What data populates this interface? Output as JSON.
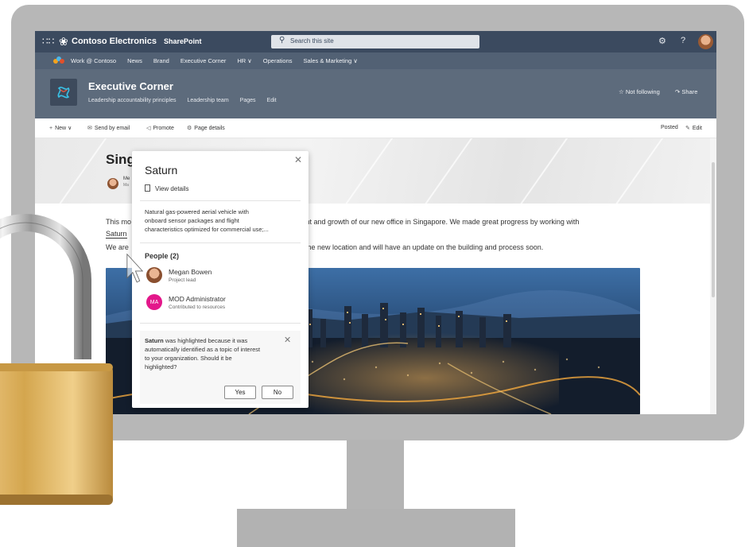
{
  "suite_bar": {
    "brand": "Contoso Electronics",
    "app": "SharePoint",
    "search_placeholder": "Search this site",
    "help": "?"
  },
  "hub_nav": {
    "items": [
      "Work @ Contoso",
      "News",
      "Brand",
      "Executive Corner",
      "HR ∨",
      "Operations",
      "Sales & Marketing ∨"
    ]
  },
  "site_header": {
    "title": "Executive Corner",
    "nav": [
      "Leadership accountability principles",
      "Leadership team",
      "Pages",
      "Edit"
    ],
    "follow": "Not following",
    "share": "Share"
  },
  "command_bar": {
    "new": "New",
    "send_email": "Send by email",
    "promote": "Promote",
    "page_details": "Page details",
    "posted": "Posted",
    "edit": "Edit"
  },
  "article": {
    "title_fragment": "Sing",
    "author_fragment": "Me",
    "author_fragment2": "Ma",
    "line1_start": "This mo",
    "line1_end": "ment and growth of our new office in Singapore. We made great progress by working with",
    "line2_link": "Saturn",
    "line3_start": "We are",
    "line3_end": "the new location and will have an update on the building and process soon."
  },
  "hover_card": {
    "title": "Saturn",
    "view_details": "View details",
    "description_lines": [
      "Natural gas-powered aerial vehicle with",
      "onboard sensor packages and flight",
      "characteristics optimized for commercial use;..."
    ],
    "people_heading": "People (2)",
    "people": [
      {
        "name": "Megan Bowen",
        "role": "Project lead",
        "initials": ""
      },
      {
        "name": "MOD Administrator",
        "role": "Contributed to resources",
        "initials": "MA"
      }
    ],
    "note_keyword": "Saturn",
    "note_line1_rest": " was highlighted because it was",
    "note_lines": [
      "automatically identified as a topic of interest",
      "to your organization. Should it be",
      "highlighted?"
    ],
    "yes": "Yes",
    "no": "No"
  },
  "colors": {
    "suite_bar": "#3b4a5f",
    "hub_nav": "#526174",
    "site_header": "#5d6b7c",
    "monitor": "#b7b7b7",
    "admin_avatar": "#e3178a",
    "padlock_body": "#d4a64e"
  },
  "icons": {
    "waffle": "waffle-icon",
    "logo": "contoso-logo-icon",
    "search": "search-icon",
    "settings": "gear-icon",
    "follow": "star-icon",
    "share": "share-icon",
    "lock": "padlock-icon"
  }
}
